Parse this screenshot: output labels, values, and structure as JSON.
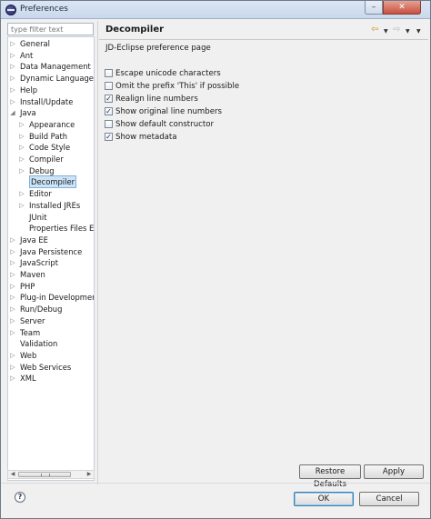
{
  "window": {
    "title": "Preferences"
  },
  "filter": {
    "placeholder": "type filter text"
  },
  "tree": [
    {
      "label": "General",
      "level": 0,
      "arrow": "collapsed"
    },
    {
      "label": "Ant",
      "level": 0,
      "arrow": "collapsed"
    },
    {
      "label": "Data Management",
      "level": 0,
      "arrow": "collapsed"
    },
    {
      "label": "Dynamic Languages",
      "level": 0,
      "arrow": "collapsed"
    },
    {
      "label": "Help",
      "level": 0,
      "arrow": "collapsed"
    },
    {
      "label": "Install/Update",
      "level": 0,
      "arrow": "collapsed"
    },
    {
      "label": "Java",
      "level": 0,
      "arrow": "expanded"
    },
    {
      "label": "Appearance",
      "level": 1,
      "arrow": "collapsed"
    },
    {
      "label": "Build Path",
      "level": 1,
      "arrow": "collapsed"
    },
    {
      "label": "Code Style",
      "level": 1,
      "arrow": "collapsed"
    },
    {
      "label": "Compiler",
      "level": 1,
      "arrow": "collapsed"
    },
    {
      "label": "Debug",
      "level": 1,
      "arrow": "collapsed"
    },
    {
      "label": "Decompiler",
      "level": 1,
      "arrow": "none",
      "selected": true
    },
    {
      "label": "Editor",
      "level": 1,
      "arrow": "collapsed"
    },
    {
      "label": "Installed JREs",
      "level": 1,
      "arrow": "collapsed"
    },
    {
      "label": "JUnit",
      "level": 1,
      "arrow": "none"
    },
    {
      "label": "Properties Files Edi",
      "level": 1,
      "arrow": "none"
    },
    {
      "label": "Java EE",
      "level": 0,
      "arrow": "collapsed"
    },
    {
      "label": "Java Persistence",
      "level": 0,
      "arrow": "collapsed"
    },
    {
      "label": "JavaScript",
      "level": 0,
      "arrow": "collapsed"
    },
    {
      "label": "Maven",
      "level": 0,
      "arrow": "collapsed"
    },
    {
      "label": "PHP",
      "level": 0,
      "arrow": "collapsed"
    },
    {
      "label": "Plug-in Development",
      "level": 0,
      "arrow": "collapsed"
    },
    {
      "label": "Run/Debug",
      "level": 0,
      "arrow": "collapsed"
    },
    {
      "label": "Server",
      "level": 0,
      "arrow": "collapsed"
    },
    {
      "label": "Team",
      "level": 0,
      "arrow": "collapsed"
    },
    {
      "label": "Validation",
      "level": 0,
      "arrow": "none"
    },
    {
      "label": "Web",
      "level": 0,
      "arrow": "collapsed"
    },
    {
      "label": "Web Services",
      "level": 0,
      "arrow": "collapsed"
    },
    {
      "label": "XML",
      "level": 0,
      "arrow": "collapsed"
    }
  ],
  "page": {
    "title": "Decompiler",
    "description": "JD-Eclipse preference page",
    "options": [
      {
        "label": "Escape unicode characters",
        "checked": false
      },
      {
        "label": "Omit the prefix 'This' if possible",
        "checked": false
      },
      {
        "label": "Realign line numbers",
        "checked": true
      },
      {
        "label": "Show original line numbers",
        "checked": true
      },
      {
        "label": "Show default constructor",
        "checked": false
      },
      {
        "label": "Show metadata",
        "checked": true
      }
    ],
    "restore_label": "Restore Defaults",
    "apply_label": "Apply"
  },
  "footer": {
    "ok_label": "OK",
    "cancel_label": "Cancel",
    "help_glyph": "?"
  },
  "icons": {
    "back": "back-arrow-icon",
    "forward": "forward-arrow-icon",
    "help": "help-icon",
    "app": "eclipse-icon"
  },
  "colors": {
    "selection": "#cce4f7",
    "nav_back": "#c9932a",
    "close": "#c75140"
  }
}
